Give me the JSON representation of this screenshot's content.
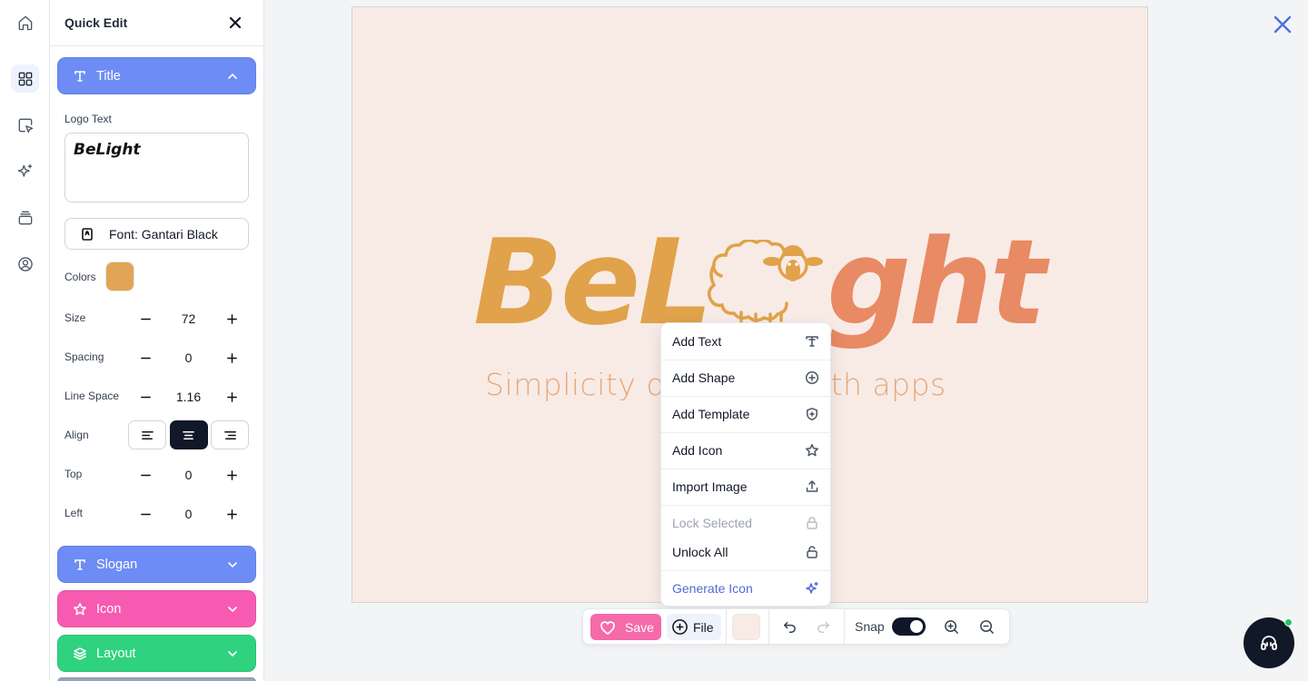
{
  "panel": {
    "title": "Quick Edit",
    "sections": {
      "title": "Title",
      "slogan": "Slogan",
      "icon": "Icon",
      "layout": "Layout"
    },
    "logo_text_label": "Logo Text",
    "logo_text_value": "BeLight",
    "font_button": "Font: Gantari Black",
    "colors_label": "Colors",
    "swatch_color": "#e0a556",
    "size": {
      "label": "Size",
      "value": "72"
    },
    "spacing": {
      "label": "Spacing",
      "value": "0"
    },
    "line_space": {
      "label": "Line Space",
      "value": "1.16"
    },
    "align": {
      "label": "Align",
      "selected": "center"
    },
    "top": {
      "label": "Top",
      "value": "0"
    },
    "left": {
      "label": "Left",
      "value": "0"
    }
  },
  "canvas": {
    "background": "#f8ebe6",
    "logo_part1": "BeL",
    "logo_part2": "ght",
    "slogan": "Simplicity of design with apps",
    "colors": {
      "primary": "#e0a24a",
      "secondary": "#e88a63",
      "slogan": "#e8a87a"
    }
  },
  "menu": {
    "items": [
      {
        "label": "Add Text",
        "icon": "text-icon"
      },
      {
        "label": "Add Shape",
        "icon": "plus-circle-icon"
      },
      {
        "label": "Add Template",
        "icon": "shield-icon"
      },
      {
        "label": "Add Icon",
        "icon": "star-icon"
      },
      {
        "label": "Import Image",
        "icon": "upload-icon"
      },
      {
        "label": "Lock Selected",
        "icon": "lock-icon"
      },
      {
        "label": "Unlock All",
        "icon": "unlock-icon"
      },
      {
        "label": "Generate Icon",
        "icon": "sparkles-icon"
      }
    ]
  },
  "toolbar": {
    "save": "Save",
    "file": "File",
    "snap": "Snap",
    "snap_on": true
  },
  "colors": {
    "accent": "#6d8cf5",
    "pink": "#f65bb1",
    "green": "#2fd27f",
    "close": "#4f6ee0"
  }
}
